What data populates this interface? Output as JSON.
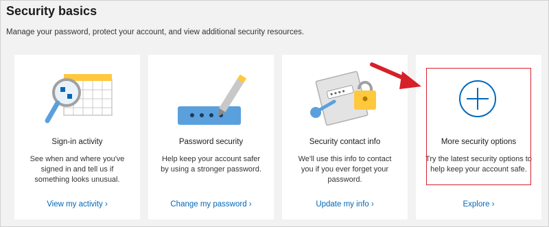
{
  "page": {
    "title": "Security basics",
    "subtitle": "Manage your password, protect your account, and view additional security resources."
  },
  "cards": [
    {
      "title": "Sign-in activity",
      "description": "See when and where you've signed in and tell us if something looks unusual.",
      "link": "View my activity ›",
      "icon": "magnifier-calendar-icon"
    },
    {
      "title": "Password security",
      "description": "Help keep your account safer by using a stronger password.",
      "link": "Change my password ›",
      "icon": "password-pen-icon"
    },
    {
      "title": "Security contact info",
      "description": "We'll use this info to contact you if you ever forget your password.",
      "link": "Update my info ›",
      "icon": "contact-lock-icon"
    },
    {
      "title": "More security options",
      "description": "Try the latest security options to help keep your account safe.",
      "link": "Explore ›",
      "icon": "plus-circle-icon"
    }
  ],
  "colors": {
    "accent": "#0067b8",
    "highlight": "#d6202a",
    "background": "#f2f2f2"
  }
}
